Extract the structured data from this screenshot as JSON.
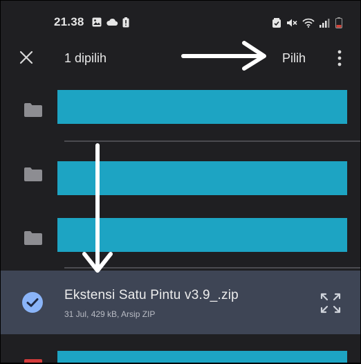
{
  "status_bar": {
    "time": "21.38",
    "icons": [
      "image-icon",
      "cloud-icon",
      "battery-alert-icon",
      "alarm-icon",
      "mute-icon",
      "wifi-icon",
      "signal-icon",
      "battery-low-icon"
    ]
  },
  "app_bar": {
    "close_icon": "close-icon",
    "selection_title": "1 dipilih",
    "select_button_label": "Pilih",
    "more_icon": "more-vert-icon"
  },
  "list": {
    "folders_redacted": 3,
    "selected_file": {
      "name": "Ekstensi Satu Pintu v3.9_.zip",
      "meta": "31 Jul, 429 kB, Arsip ZIP",
      "check_icon": "check-circle-icon",
      "expand_icon": "expand-icon"
    }
  },
  "colors": {
    "background": "#1f1f22",
    "redaction": "#1da4c3",
    "selected_row": "#3e4555",
    "check_accent": "#8ab4f8"
  }
}
